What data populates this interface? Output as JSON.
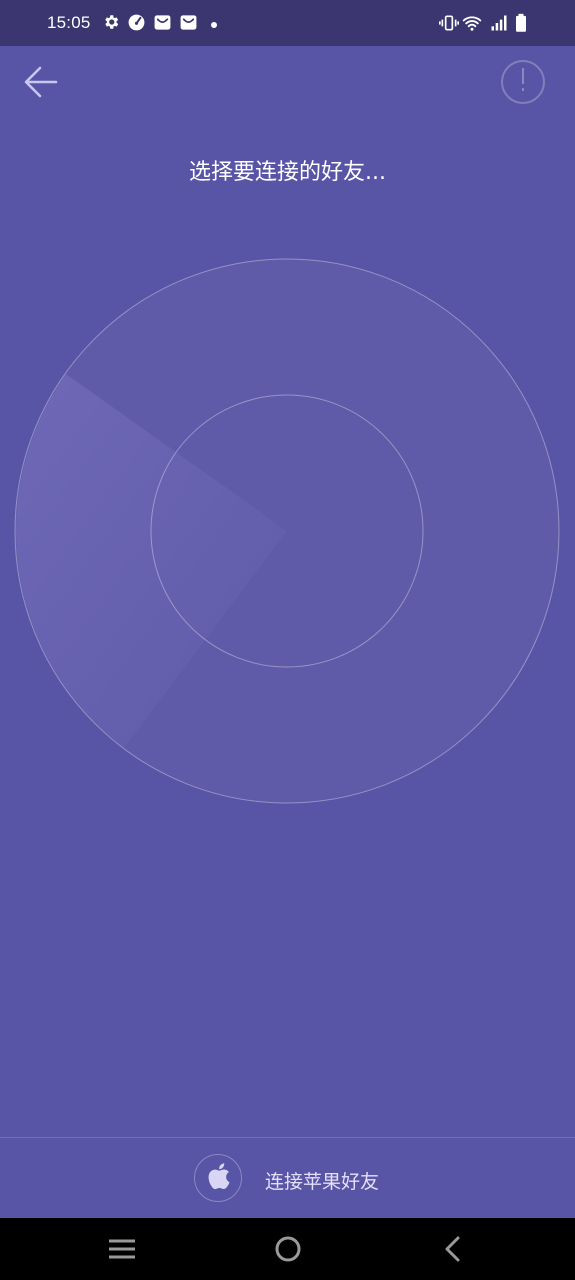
{
  "status_bar": {
    "time": "15:05",
    "left_icons": [
      "gear-icon",
      "speedometer-icon",
      "mail-bag-icon",
      "mail-bag-icon",
      "dot-icon"
    ],
    "right_icons": [
      "vibrate-icon",
      "wifi-icon",
      "signal-icon",
      "battery-icon"
    ]
  },
  "header": {
    "back_icon": "arrow-left-icon",
    "info_icon": "exclamation-icon"
  },
  "main": {
    "title": "选择要连接的好友..."
  },
  "bottom": {
    "apple_icon": "apple-icon",
    "label": "连接苹果好友"
  },
  "nav_bar": {
    "items": [
      "menu-icon",
      "home-icon",
      "back-icon"
    ]
  },
  "colors": {
    "background": "#5955a6",
    "status_bar": "#3b366f",
    "nav_bar": "#000000",
    "text": "#ffffff"
  }
}
